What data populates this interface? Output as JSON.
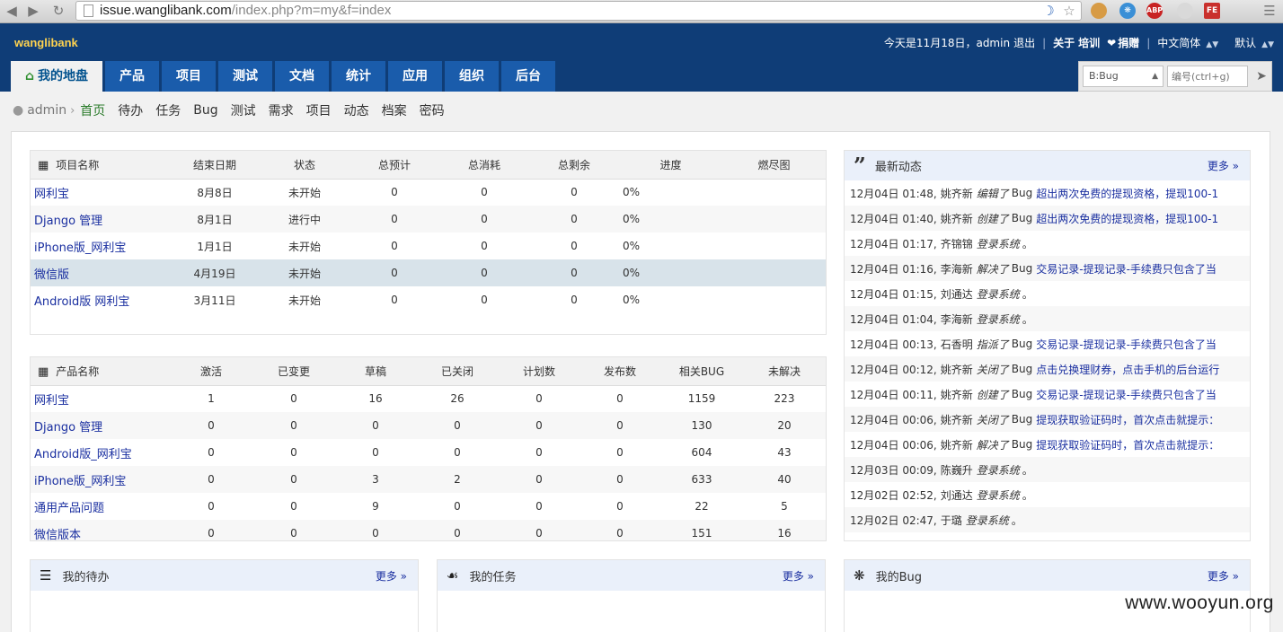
{
  "browser": {
    "url_host": "issue.wanglibank.com",
    "url_path": "/index.php?m=my&f=index"
  },
  "header": {
    "brand": "wanglibank",
    "greeting": "今天是11月18日，admin",
    "logout": "退出",
    "about": "关于",
    "training": "培训",
    "donate": "捐赠",
    "language": "中文简体",
    "theme": "默认"
  },
  "mainnav": [
    {
      "label": "我的地盘",
      "active": true
    },
    {
      "label": "产品"
    },
    {
      "label": "项目"
    },
    {
      "label": "测试"
    },
    {
      "label": "文档"
    },
    {
      "label": "统计"
    },
    {
      "label": "应用"
    },
    {
      "label": "组织"
    },
    {
      "label": "后台"
    }
  ],
  "search": {
    "type_value": "B:Bug",
    "placeholder": "编号(ctrl+g)"
  },
  "subnav": {
    "user": "admin",
    "items": [
      "首页",
      "待办",
      "任务",
      "Bug",
      "测试",
      "需求",
      "项目",
      "动态",
      "档案",
      "密码"
    ]
  },
  "projects": {
    "headers": [
      "项目名称",
      "结束日期",
      "状态",
      "总预计",
      "总消耗",
      "总剩余",
      "进度",
      "燃尽图"
    ],
    "rows": [
      [
        "网利宝",
        "8月8日",
        "未开始",
        "0",
        "0",
        "0",
        "0%"
      ],
      [
        "Django 管理",
        "8月1日",
        "进行中",
        "0",
        "0",
        "0",
        "0%"
      ],
      [
        "iPhone版_网利宝",
        "1月1日",
        "未开始",
        "0",
        "0",
        "0",
        "0%"
      ],
      [
        "微信版",
        "4月19日",
        "未开始",
        "0",
        "0",
        "0",
        "0%"
      ],
      [
        "Android版 网利宝",
        "3月11日",
        "未开始",
        "0",
        "0",
        "0",
        "0%"
      ]
    ]
  },
  "products": {
    "headers": [
      "产品名称",
      "激活",
      "已变更",
      "草稿",
      "已关闭",
      "计划数",
      "发布数",
      "相关BUG",
      "未解决"
    ],
    "rows": [
      [
        "网利宝",
        "1",
        "0",
        "16",
        "26",
        "0",
        "0",
        "1159",
        "223"
      ],
      [
        "Django 管理",
        "0",
        "0",
        "0",
        "0",
        "0",
        "0",
        "130",
        "20"
      ],
      [
        "Android版_网利宝",
        "0",
        "0",
        "0",
        "0",
        "0",
        "0",
        "604",
        "43"
      ],
      [
        "iPhone版_网利宝",
        "0",
        "0",
        "3",
        "2",
        "0",
        "0",
        "633",
        "40"
      ],
      [
        "通用产品问题",
        "0",
        "0",
        "9",
        "0",
        "0",
        "0",
        "22",
        "5"
      ],
      [
        "微信版本",
        "0",
        "0",
        "0",
        "0",
        "0",
        "0",
        "151",
        "16"
      ]
    ]
  },
  "dynamics": {
    "title": "最新动态",
    "more": "更多",
    "items": [
      {
        "time": "12月04日 01:48,",
        "who": "姚齐新",
        "action": "编辑了",
        "obj": "Bug",
        "link": "超出两次免费的提现资格，提现100-1"
      },
      {
        "time": "12月04日 01:40,",
        "who": "姚齐新",
        "action": "创建了",
        "obj": "Bug",
        "link": "超出两次免费的提现资格，提现100-1"
      },
      {
        "time": "12月04日 01:17,",
        "who": "齐锦锦",
        "action": "登录系统",
        "obj": "。",
        "link": ""
      },
      {
        "time": "12月04日 01:16,",
        "who": "李海新",
        "action": "解决了",
        "obj": "Bug",
        "link": "交易记录-提现记录-手续费只包含了当"
      },
      {
        "time": "12月04日 01:15,",
        "who": "刘通达",
        "action": "登录系统",
        "obj": "。",
        "link": ""
      },
      {
        "time": "12月04日 01:04,",
        "who": "李海新",
        "action": "登录系统",
        "obj": "。",
        "link": ""
      },
      {
        "time": "12月04日 00:13,",
        "who": "石香明",
        "action": "指派了",
        "obj": "Bug",
        "link": "交易记录-提现记录-手续费只包含了当"
      },
      {
        "time": "12月04日 00:12,",
        "who": "姚齐新",
        "action": "关闭了",
        "obj": "Bug",
        "link": "点击兑换理财券，点击手机的后台运行"
      },
      {
        "time": "12月04日 00:11,",
        "who": "姚齐新",
        "action": "创建了",
        "obj": "Bug",
        "link": "交易记录-提现记录-手续费只包含了当"
      },
      {
        "time": "12月04日 00:06,",
        "who": "姚齐新",
        "action": "关闭了",
        "obj": "Bug",
        "link": "提现获取验证码时，首次点击就提示："
      },
      {
        "time": "12月04日 00:06,",
        "who": "姚齐新",
        "action": "解决了",
        "obj": "Bug",
        "link": "提现获取验证码时，首次点击就提示："
      },
      {
        "time": "12月03日 00:09,",
        "who": "陈巍升",
        "action": "登录系统",
        "obj": "。",
        "link": ""
      },
      {
        "time": "12月02日 02:52,",
        "who": "刘通达",
        "action": "登录系统",
        "obj": "。",
        "link": ""
      },
      {
        "time": "12月02日 02:47,",
        "who": "于璐",
        "action": "登录系统",
        "obj": "。",
        "link": ""
      }
    ]
  },
  "blocks": {
    "todo": {
      "title": "我的待办",
      "more": "更多"
    },
    "tasks": {
      "title": "我的任务",
      "more": "更多"
    },
    "bugs": {
      "title": "我的Bug",
      "more": "更多"
    }
  },
  "watermark": "www.wooyun.org",
  "colors": {
    "header_bg": "#0f3d77",
    "nav_bg": "#1a5cab",
    "brand": "#ffd34f",
    "link": "#1a2fa0",
    "active_green": "#2a7b2a"
  }
}
